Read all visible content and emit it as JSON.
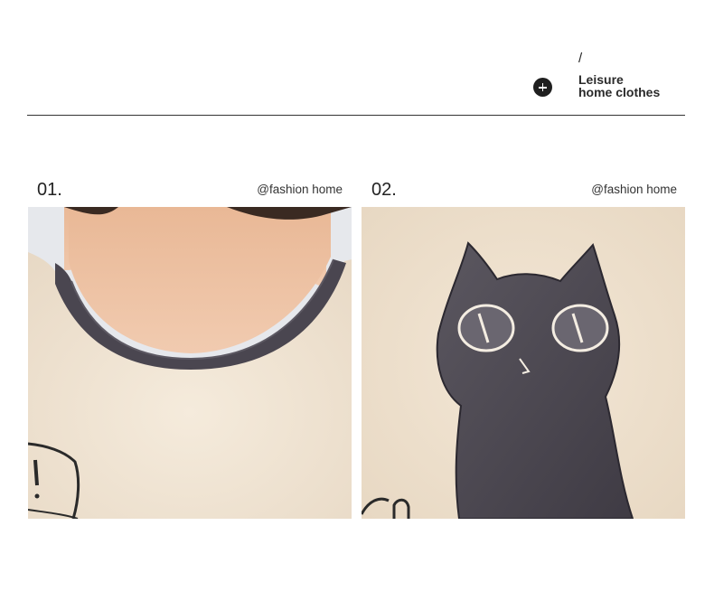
{
  "header": {
    "slash": "/",
    "title_line1": "Leisure",
    "title_line2": "home clothes",
    "icon": "plus-circle-icon"
  },
  "cards": [
    {
      "number": "01.",
      "tag": "@fashion home",
      "image": "photo of a neckline with grey ribbed collar on a cream fleece top"
    },
    {
      "number": "02.",
      "tag": "@fashion home",
      "image": "photo of a grey embroidered cat applique on cream fleece fabric"
    }
  ],
  "colors": {
    "fabric": "#efe3d2",
    "trim": "#4a4650",
    "cat": "#4f4b52",
    "skin": "#efc6a6",
    "text": "#222222"
  }
}
